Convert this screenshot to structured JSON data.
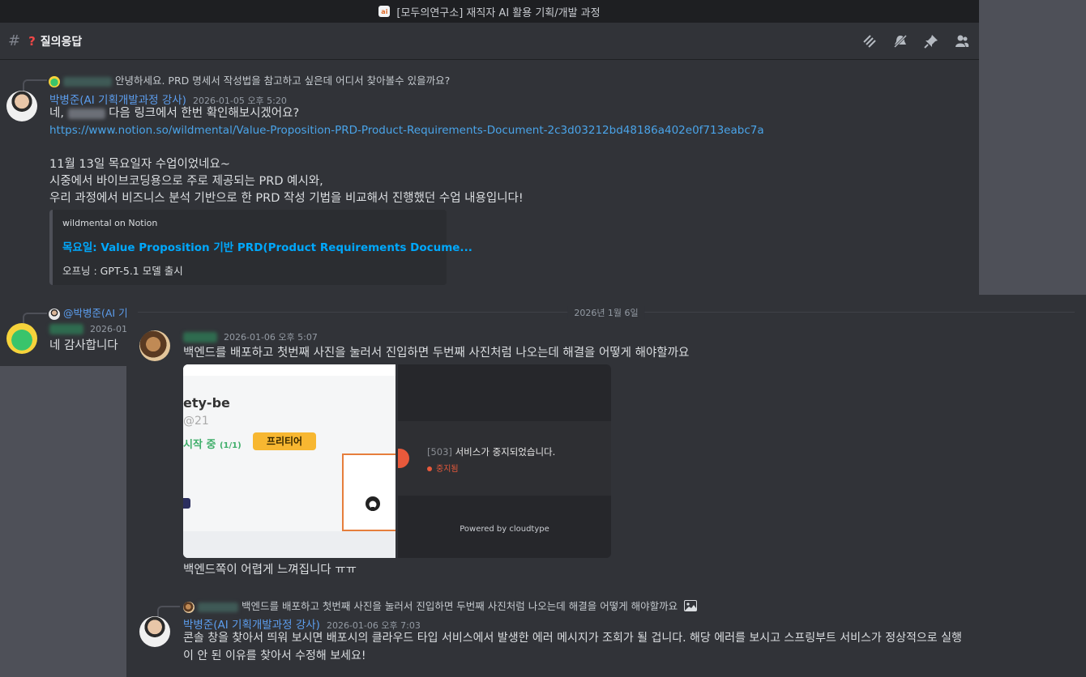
{
  "window": {
    "title": "[모두의연구소] 재직자 AI 활용 기획/개발 과정"
  },
  "channel": {
    "name": "질의응답"
  },
  "thread1": {
    "reply_preview": "안녕하세요. PRD 명세서 작성법을 참고하고 싶은데 어디서 찾아볼수 있을까요?",
    "author": "박병준(AI 기획개발과정 강사)",
    "timestamp": "2026-01-05 오후 5:20",
    "line1_prefix": "네,",
    "line1_suffix": "다음 링크에서 한번 확인해보시겠어요?",
    "link": "https://www.notion.so/wildmental/Value-Proposition-PRD-Product-Requirements-Document-2c3d03212bd48186a402e0f713eabc7a",
    "line3": "11월 13일 목요일자 수업이었네요~",
    "line4": "시중에서 바이브코딩용으로 주로 제공되는 PRD 예시와,",
    "line5": "우리 과정에서 비즈니스 분석 기반으로 한 PRD 작성 기법을 비교해서 진행했던 수업 내용입니다!",
    "embed": {
      "provider": "wildmental on Notion",
      "title": "목요일: Value Proposition 기반 PRD(Product Requirements Docume...",
      "description": "오프닝 : GPT-5.1 모델 출시"
    }
  },
  "thread2": {
    "reply_mention": "@박병준(AI 기",
    "timestamp": "2026-01",
    "text": "네 감사합니다"
  },
  "date_divider": "2026년 1월 6일",
  "thread3": {
    "timestamp": "2026-01-06 오후 5:07",
    "text": "백엔드를 배포하고 첫번째 사진을  눌러서 진입하면 두번째 사진처럼 나오는데 해결을 어떻게 해야할까요",
    "image1": {
      "title": "ety-be",
      "sub": "@21",
      "status": "시작 중",
      "count": "(1/1)",
      "badge": "프리티어"
    },
    "image2": {
      "code": "[503]",
      "message": "서비스가 중지되었습니다.",
      "status": "중지됨",
      "footer": "Powered by cloudtype"
    },
    "followup": "백엔드쪽이 어렵게 느껴집니다 ㅠㅠ"
  },
  "thread4": {
    "reply_preview": "백엔드를 배포하고 첫번째 사진을  눌러서 진입하면 두번째 사진처럼 나오는데 해결을 어떻게 해야할까요",
    "author": "박병준(AI 기획개발과정 강사)",
    "timestamp": "2026-01-06 오후 7:03",
    "line1": "콘솔 창을 찾아서 띄워 보시면 배포시의 클라우드 타입 서비스에서 발생한 에러 메시지가 조회가 될 겁니다. 해당 에러를 보시고 스프링부트 서비스가 정상적으로 실행",
    "line2": "이 안 된 이유를 찾아서 수정해 보세요!"
  },
  "icons": [
    "threads-icon",
    "mute-icon",
    "pin-icon",
    "members-icon",
    "hash-icon",
    "question-icon",
    "image-icon",
    "github-icon"
  ]
}
